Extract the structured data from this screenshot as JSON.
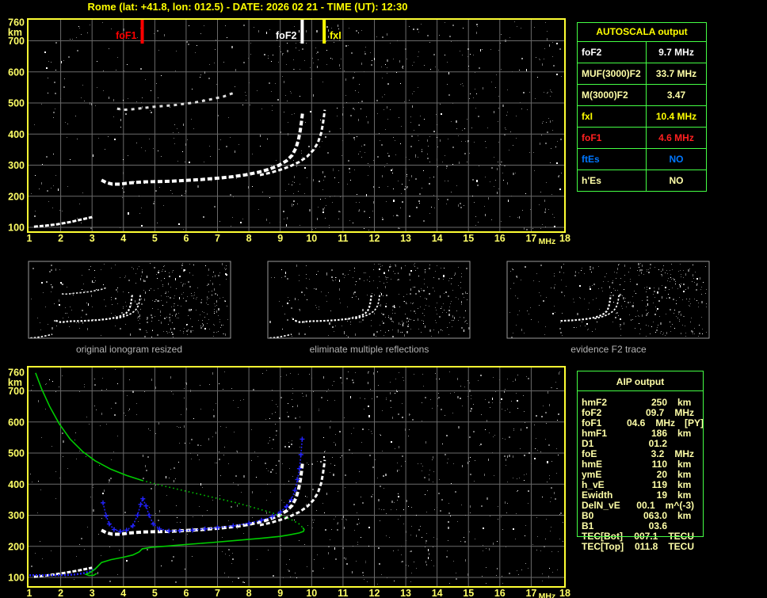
{
  "title": "Rome (lat: +41.8, lon: 012.5) - DATE: 2026 02 21 - TIME (UT): 12:30",
  "colors": {
    "background": "#000000",
    "title_yellow": "#ffff00",
    "axis_yellow": "#ffff66",
    "pale_yellow": "#ffffa8",
    "grid_gray": "#6a6a6a",
    "plot_border": "#ffff33",
    "table_border_green": "#44ff44",
    "profile_green": "#00cc00",
    "trace_blue": "#2222ff",
    "marker_red": "#ff0000",
    "caption_gray": "#b4b4b4",
    "trace_white": "#ffffff"
  },
  "autoscala_table": {
    "title": "AUTOSCALA output",
    "rows": [
      {
        "label": "foF2",
        "value": "9.7 MHz",
        "color": "#ffffff"
      },
      {
        "label": "MUF(3000)F2",
        "value": "33.7 MHz",
        "color": "#ffffa8"
      },
      {
        "label": "M(3000)F2",
        "value": "3.47",
        "color": "#ffffa8"
      },
      {
        "label": "fxI",
        "value": "10.4 MHz",
        "color": "#ffff00"
      },
      {
        "label": "foF1",
        "value": "4.6 MHz",
        "color": "#ff2020"
      },
      {
        "label": "ftEs",
        "value": "NO",
        "color": "#0077ff"
      },
      {
        "label": "h'Es",
        "value": "NO",
        "color": "#ffffa8"
      }
    ]
  },
  "aip_table": {
    "title": "AIP output",
    "rows": [
      {
        "label": "hmF2",
        "value": "250",
        "unit": "km",
        "note": ""
      },
      {
        "label": "foF2",
        "value": "09.7",
        "unit": "MHz",
        "note": ""
      },
      {
        "label": "foF1",
        "value": "04.6",
        "unit": "MHz",
        "note": "[PY]"
      },
      {
        "label": "hmF1",
        "value": "186",
        "unit": "km",
        "note": ""
      },
      {
        "label": "D1",
        "value": "01.2",
        "unit": "",
        "note": ""
      },
      {
        "label": "foE",
        "value": "3.2",
        "unit": "MHz",
        "note": ""
      },
      {
        "label": "hmE",
        "value": "110",
        "unit": "km",
        "note": ""
      },
      {
        "label": "ymE",
        "value": "20",
        "unit": "km",
        "note": ""
      },
      {
        "label": "h_vE",
        "value": "119",
        "unit": "km",
        "note": ""
      },
      {
        "label": "Ewidth",
        "value": "19",
        "unit": "km",
        "note": ""
      },
      {
        "label": "DelN_vE",
        "value": "00.1",
        "unit": "m^(-3)",
        "note": ""
      },
      {
        "label": "B0",
        "value": "063.0",
        "unit": "km",
        "note": ""
      },
      {
        "label": "B1",
        "value": "03.6",
        "unit": "",
        "note": ""
      },
      {
        "label": "TEC[Bot]",
        "value": "007.1",
        "unit": "TECU",
        "note": ""
      },
      {
        "label": "TEC[Top]",
        "value": "011.8",
        "unit": "TECU",
        "note": ""
      }
    ]
  },
  "thumbnails": [
    {
      "caption": "original ionogram resized"
    },
    {
      "caption": "eliminate multiple reflections"
    },
    {
      "caption": "evidence F2 trace"
    }
  ],
  "chart_data": [
    {
      "type": "scatter",
      "title": "top ionogram with autoscaled characteristics",
      "xlabel": "MHz",
      "ylabel": "km",
      "x_ticks": [
        1,
        2,
        3,
        4,
        5,
        6,
        7,
        8,
        9,
        10,
        11,
        12,
        13,
        14,
        15,
        16,
        17,
        18
      ],
      "y_ticks": [
        760,
        700,
        600,
        500,
        400,
        300,
        200,
        100
      ],
      "xlim": [
        1,
        18
      ],
      "ylim": [
        100,
        760
      ],
      "grid": true,
      "markers": [
        {
          "label": "foF1",
          "freq": 4.6,
          "color": "#ff0000",
          "side": "left"
        },
        {
          "label": "foF2",
          "freq": 9.7,
          "color": "#ffffff",
          "side": "left"
        },
        {
          "label": "fxI",
          "freq": 10.4,
          "color": "#ffff00",
          "side": "right"
        }
      ],
      "series": [
        {
          "name": "es-trace",
          "color": "#ffffff",
          "width": 3,
          "dash": "5 2",
          "points": [
            [
              1.15,
              102
            ],
            [
              1.5,
              105
            ],
            [
              1.9,
              110
            ],
            [
              2.3,
              117
            ],
            [
              2.7,
              126
            ],
            [
              3.0,
              133
            ]
          ]
        },
        {
          "name": "f-trace-ordinary",
          "color": "#ffffff",
          "width": 4,
          "dash": "6 3",
          "points": [
            [
              3.3,
              252
            ],
            [
              3.45,
              244
            ],
            [
              3.65,
              239
            ],
            [
              3.9,
              239
            ],
            [
              4.2,
              243
            ],
            [
              4.6,
              246
            ],
            [
              5.0,
              247
            ],
            [
              5.5,
              248
            ],
            [
              6.0,
              251
            ],
            [
              6.5,
              254
            ],
            [
              7.0,
              258
            ],
            [
              7.5,
              263
            ],
            [
              7.9,
              269
            ],
            [
              8.3,
              277
            ],
            [
              8.65,
              287
            ],
            [
              8.95,
              299
            ],
            [
              9.2,
              314
            ],
            [
              9.38,
              332
            ],
            [
              9.5,
              355
            ],
            [
              9.58,
              382
            ],
            [
              9.64,
              412
            ],
            [
              9.68,
              442
            ],
            [
              9.71,
              468
            ]
          ]
        },
        {
          "name": "f-trace-extraordinary",
          "color": "#ffffff",
          "width": 3,
          "dash": "5 3",
          "points": [
            [
              8.35,
              268
            ],
            [
              8.7,
              276
            ],
            [
              9.0,
              285
            ],
            [
              9.3,
              296
            ],
            [
              9.6,
              310
            ],
            [
              9.85,
              327
            ],
            [
              10.05,
              348
            ],
            [
              10.2,
              372
            ],
            [
              10.3,
              402
            ],
            [
              10.36,
              432
            ],
            [
              10.4,
              462
            ],
            [
              10.42,
              478
            ]
          ]
        },
        {
          "name": "second-hop-trace",
          "color": "#dddddd",
          "width": 3,
          "dash": "4 5",
          "points": [
            [
              3.8,
              482
            ],
            [
              4.0,
              478
            ],
            [
              4.3,
              480
            ],
            [
              5.0,
              488
            ],
            [
              5.7,
              494
            ],
            [
              6.3,
              502
            ],
            [
              6.8,
              512
            ],
            [
              7.2,
              521
            ],
            [
              7.5,
              532
            ]
          ]
        }
      ]
    },
    {
      "type": "scatter",
      "title": "bottom ionogram with restored trace and electron density profile",
      "xlabel": "MHz",
      "ylabel": "km",
      "x_ticks": [
        1,
        2,
        3,
        4,
        5,
        6,
        7,
        8,
        9,
        10,
        11,
        12,
        13,
        14,
        15,
        16,
        17,
        18
      ],
      "y_ticks": [
        760,
        700,
        600,
        500,
        400,
        300,
        200,
        100
      ],
      "xlim": [
        1,
        18
      ],
      "ylim": [
        100,
        760
      ],
      "grid": true,
      "markers": [],
      "series": [
        {
          "name": "es-trace",
          "color": "#ffffff",
          "width": 3,
          "dash": "5 2",
          "points": [
            [
              1.15,
              102
            ],
            [
              1.6,
              107
            ],
            [
              2.1,
              114
            ],
            [
              2.6,
              123
            ],
            [
              3.0,
              131
            ]
          ]
        },
        {
          "name": "f-trace-ordinary",
          "color": "#ffffff",
          "width": 4,
          "dash": "6 3",
          "points": [
            [
              3.3,
              252
            ],
            [
              3.45,
              244
            ],
            [
              3.65,
              239
            ],
            [
              3.9,
              239
            ],
            [
              4.2,
              243
            ],
            [
              4.6,
              246
            ],
            [
              5.0,
              247
            ],
            [
              5.5,
              248
            ],
            [
              6.0,
              251
            ],
            [
              6.5,
              254
            ],
            [
              7.0,
              258
            ],
            [
              7.5,
              263
            ],
            [
              7.9,
              269
            ],
            [
              8.3,
              277
            ],
            [
              8.65,
              287
            ],
            [
              8.95,
              299
            ],
            [
              9.2,
              314
            ],
            [
              9.38,
              332
            ],
            [
              9.5,
              355
            ],
            [
              9.58,
              382
            ],
            [
              9.64,
              412
            ],
            [
              9.68,
              442
            ],
            [
              9.71,
              468
            ]
          ]
        },
        {
          "name": "f-trace-extraordinary",
          "color": "#ffffff",
          "width": 3,
          "dash": "5 3",
          "points": [
            [
              8.35,
              268
            ],
            [
              8.7,
              276
            ],
            [
              9.0,
              285
            ],
            [
              9.3,
              296
            ],
            [
              9.6,
              310
            ],
            [
              9.85,
              327
            ],
            [
              10.05,
              348
            ],
            [
              10.2,
              372
            ],
            [
              10.3,
              402
            ],
            [
              10.36,
              432
            ],
            [
              10.4,
              462
            ],
            [
              10.42,
              478
            ]
          ]
        },
        {
          "name": "es-restored-blue",
          "color": "#2222ff",
          "width": 2.5,
          "dash": "2 2",
          "points": [
            [
              1.0,
              107
            ],
            [
              1.4,
              107
            ],
            [
              1.8,
              107
            ],
            [
              2.2,
              108
            ],
            [
              2.5,
              110
            ],
            [
              2.75,
              114
            ],
            [
              2.95,
              120
            ],
            [
              3.1,
              127
            ]
          ]
        },
        {
          "name": "autoscaled-trace-blue",
          "color": "#2222ff",
          "width": 1.5,
          "dash": "2 2",
          "crosses": true,
          "points": [
            [
              3.35,
              340
            ],
            [
              3.45,
              298
            ],
            [
              3.55,
              272
            ],
            [
              3.7,
              254
            ],
            [
              3.9,
              248
            ],
            [
              4.1,
              252
            ],
            [
              4.3,
              266
            ],
            [
              4.45,
              300
            ],
            [
              4.55,
              335
            ],
            [
              4.62,
              353
            ],
            [
              4.72,
              330
            ],
            [
              4.82,
              300
            ],
            [
              4.95,
              272
            ],
            [
              5.15,
              256
            ],
            [
              5.45,
              249
            ],
            [
              5.8,
              250
            ],
            [
              6.2,
              252
            ],
            [
              6.6,
              256
            ],
            [
              7.0,
              260
            ],
            [
              7.5,
              266
            ],
            [
              8.0,
              274
            ],
            [
              8.4,
              284
            ],
            [
              8.75,
              296
            ],
            [
              9.0,
              310
            ],
            [
              9.2,
              328
            ],
            [
              9.35,
              350
            ],
            [
              9.47,
              380
            ],
            [
              9.55,
              415
            ],
            [
              9.61,
              450
            ],
            [
              9.66,
              495
            ],
            [
              9.7,
              545
            ]
          ]
        },
        {
          "name": "profile-topside",
          "color": "#00cc00",
          "width": 1.6,
          "dash": null,
          "points": [
            [
              1.2,
              758
            ],
            [
              1.4,
              705
            ],
            [
              1.65,
              650
            ],
            [
              1.95,
              595
            ],
            [
              2.3,
              545
            ],
            [
              2.7,
              505
            ],
            [
              3.1,
              475
            ],
            [
              3.6,
              448
            ],
            [
              4.1,
              428
            ],
            [
              4.6,
              412
            ]
          ]
        },
        {
          "name": "profile-valley-dotted",
          "color": "#00cc00",
          "width": 1.6,
          "dash": "1.5 3.5",
          "points": [
            [
              4.6,
              412
            ],
            [
              5.2,
              396
            ],
            [
              5.8,
              382
            ],
            [
              6.4,
              368
            ],
            [
              7.0,
              354
            ],
            [
              7.6,
              340
            ],
            [
              8.1,
              326
            ],
            [
              8.6,
              312
            ],
            [
              9.0,
              299
            ],
            [
              9.35,
              286
            ],
            [
              9.6,
              272
            ],
            [
              9.72,
              260
            ]
          ]
        },
        {
          "name": "profile-bottomside",
          "color": "#00cc00",
          "width": 1.6,
          "dash": null,
          "points": [
            [
              9.72,
              260
            ],
            [
              9.76,
              254
            ],
            [
              9.74,
              248
            ],
            [
              9.6,
              243
            ],
            [
              9.3,
              237
            ],
            [
              9.0,
              232
            ],
            [
              8.4,
              226
            ],
            [
              7.6,
              219
            ],
            [
              6.8,
              212
            ],
            [
              6.0,
              206
            ],
            [
              5.4,
              201
            ],
            [
              4.9,
              197
            ],
            [
              4.6,
              192
            ],
            [
              4.5,
              182
            ],
            [
              4.3,
              172
            ],
            [
              4.0,
              165
            ],
            [
              3.6,
              157
            ],
            [
              3.3,
              148
            ],
            [
              3.1,
              127
            ],
            [
              2.95,
              116
            ],
            [
              2.8,
              110
            ],
            [
              2.9,
              106
            ],
            [
              3.05,
              107
            ],
            [
              3.15,
              113
            ]
          ]
        }
      ]
    }
  ]
}
